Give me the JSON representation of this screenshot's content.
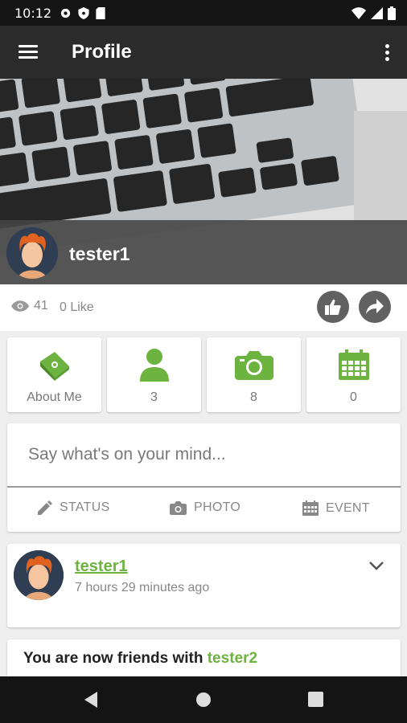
{
  "status_bar": {
    "time": "10:12"
  },
  "app_bar": {
    "title": "Profile"
  },
  "profile": {
    "username": "tester1"
  },
  "stats": {
    "views": "41",
    "likes": "0 Like"
  },
  "tiles": [
    {
      "label": "About Me",
      "icon": "book-icon"
    },
    {
      "label": "3",
      "icon": "person-icon"
    },
    {
      "label": "8",
      "icon": "camera-icon"
    },
    {
      "label": "0",
      "icon": "calendar-icon"
    }
  ],
  "composer": {
    "placeholder": "Say what's on your mind...",
    "actions": [
      "STATUS",
      "PHOTO",
      "EVENT"
    ]
  },
  "feed": {
    "author": "tester1",
    "time_ago": "7 hours 29 minutes ago"
  },
  "friend_activity": {
    "prefix": "You are now friends with ",
    "friend": "tester2"
  },
  "colors": {
    "accent_green": "#6cb33f",
    "app_bar": "#2b2b2b",
    "status_bar": "#141414"
  }
}
